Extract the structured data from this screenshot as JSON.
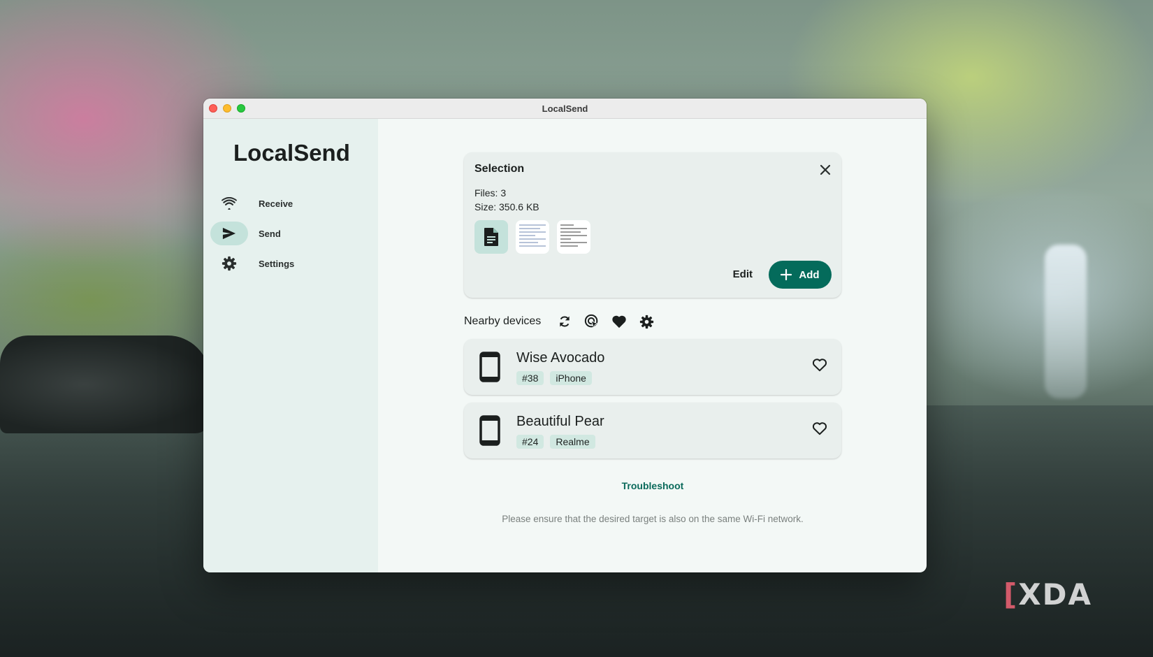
{
  "window": {
    "title": "LocalSend"
  },
  "sidebar": {
    "brand": "LocalSend",
    "items": [
      {
        "label": "Receive",
        "icon": "wifi-icon",
        "active": false
      },
      {
        "label": "Send",
        "icon": "send-icon",
        "active": true
      },
      {
        "label": "Settings",
        "icon": "gear-icon",
        "active": false
      }
    ]
  },
  "selection": {
    "title": "Selection",
    "files": "Files: 3",
    "size": "Size: 350.6 KB",
    "edit_label": "Edit",
    "add_label": "Add"
  },
  "nearby": {
    "label": "Nearby devices",
    "devices": [
      {
        "name": "Wise Avocado",
        "id": "#38",
        "type": "iPhone"
      },
      {
        "name": "Beautiful Pear",
        "id": "#24",
        "type": "Realme"
      }
    ]
  },
  "troubleshoot": "Troubleshoot",
  "hint": "Please ensure that the desired target is also on the same Wi-Fi network.",
  "watermark": "XDA",
  "colors": {
    "accent": "#046b5b",
    "sidebar_bg": "#e6f1ee",
    "card_bg": "#e9efed",
    "tag_bg": "#d1e8e1"
  }
}
